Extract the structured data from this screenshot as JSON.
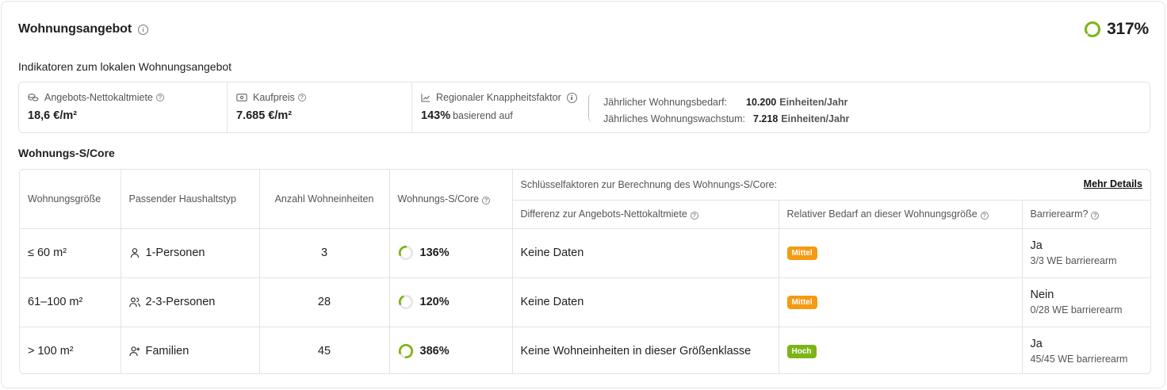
{
  "header": {
    "title": "Wohnungsangebot",
    "total_value": "317%",
    "total_fraction": 1.0
  },
  "indicators_section": {
    "label": "Indikatoren zum lokalen Wohnungsangebot",
    "items": [
      {
        "icon": "coins-icon",
        "label": "Angebots-Nettokaltmiete",
        "value": "18,6 €/m²"
      },
      {
        "icon": "banknote-icon",
        "label": "Kaufpreis",
        "value": "7.685 €/m²"
      },
      {
        "icon": "chart-line-icon",
        "label": "Regionaler Knappheitsfaktor",
        "value": "143%",
        "value_sub": "basierend auf"
      }
    ],
    "knappheit_details": [
      {
        "label": "Jährlicher Wohnungsbedarf:",
        "value": "10.200",
        "unit": "Einheiten/Jahr"
      },
      {
        "label": "Jährliches Wohnungswachstum:",
        "value": "7.218",
        "unit": "Einheiten/Jahr"
      }
    ]
  },
  "score_section": {
    "label": "Wohnungs-S/Core",
    "columns": {
      "size": "Wohnungsgröße",
      "household": "Passender Haushaltstyp",
      "units": "Anzahl Wohneinheiten",
      "score": "Wohnungs-S/Core",
      "key_factors": "Schlüsselfaktoren zur Berechnung des Wohnungs-S/Core:",
      "more_details": "Mehr Details",
      "rent_diff": "Differenz zur Angebots-Nettokaltmiete",
      "relative_demand": "Relativer Bedarf an dieser Wohnungsgröße",
      "accessible": "Barrierearm?"
    },
    "rows": [
      {
        "size": "≤ 60 m²",
        "household_icon": "person-icon",
        "household": "1-Personen",
        "units": "3",
        "score": "136%",
        "score_fraction": 0.3,
        "rent_diff": "Keine Daten",
        "demand": "Mittel",
        "demand_color": "#f59a12",
        "accessible": "Ja",
        "accessible_sub": "3/3 WE barrierearm"
      },
      {
        "size": "61–100 m²",
        "household_icon": "people-icon",
        "household": "2-3-Personen",
        "units": "28",
        "score": "120%",
        "score_fraction": 0.22,
        "rent_diff": "Keine Daten",
        "demand": "Mittel",
        "demand_color": "#f59a12",
        "accessible": "Nein",
        "accessible_sub": "0/28 WE barrierearm"
      },
      {
        "size": "> 100 m²",
        "household_icon": "family-icon",
        "household": "Familien",
        "units": "45",
        "score": "386%",
        "score_fraction": 0.8,
        "rent_diff": "Keine Wohneinheiten in dieser Größenklasse",
        "demand": "Hoch",
        "demand_color": "#7cb518",
        "accessible": "Ja",
        "accessible_sub": "45/45 WE barrierearm"
      }
    ]
  },
  "colors": {
    "accent_green": "#7cb518",
    "accent_orange": "#f59a12",
    "border": "#e3e3e3"
  }
}
